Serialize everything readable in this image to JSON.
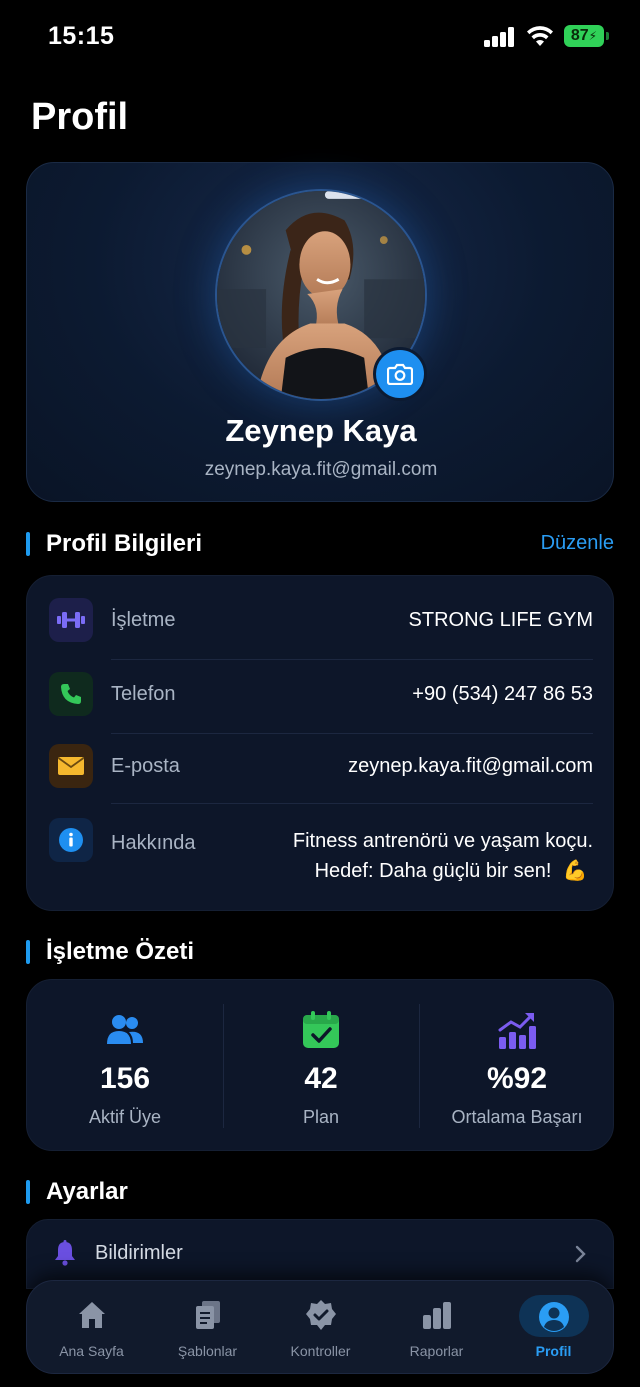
{
  "status_bar": {
    "time": "15:15",
    "battery": "87"
  },
  "page": {
    "title": "Profil"
  },
  "profile": {
    "name": "Zeynep Kaya",
    "email": "zeynep.kaya.fit@gmail.com"
  },
  "profile_info": {
    "title": "Profil Bilgileri",
    "edit_label": "Düzenle",
    "rows": [
      {
        "label": "İşletme",
        "value": "STRONG LIFE GYM",
        "icon": "dumbbell-icon"
      },
      {
        "label": "Telefon",
        "value": "+90 (534) 247 86 53",
        "icon": "phone-icon"
      },
      {
        "label": "E-posta",
        "value": "zeynep.kaya.fit@gmail.com",
        "icon": "mail-icon"
      },
      {
        "label": "Hakkında",
        "value_line1": "Fitness antrenörü ve yaşam koçu.",
        "value_line2": "Hedef: Daha güçlü bir sen!",
        "emoji": "💪",
        "icon": "info-icon"
      }
    ]
  },
  "business_summary": {
    "title": "İşletme Özeti",
    "stats": [
      {
        "value": "156",
        "label": "Aktif Üye",
        "icon": "users-icon",
        "color": "#2a8cf0"
      },
      {
        "value": "42",
        "label": "Plan",
        "icon": "calendar-check-icon",
        "color": "#34c759"
      },
      {
        "value": "%92",
        "label": "Ortalama Başarı",
        "icon": "growth-chart-icon",
        "color": "#7b5cf0"
      }
    ]
  },
  "settings": {
    "title": "Ayarlar",
    "items": [
      {
        "label": "Bildirimler",
        "icon": "bell-icon"
      }
    ]
  },
  "tab_bar": {
    "tabs": [
      {
        "label": "Ana Sayfa",
        "icon": "home-icon",
        "active": false
      },
      {
        "label": "Şablonlar",
        "icon": "documents-icon",
        "active": false
      },
      {
        "label": "Kontroller",
        "icon": "verified-badge-icon",
        "active": false
      },
      {
        "label": "Raporlar",
        "icon": "bar-chart-icon",
        "active": false
      },
      {
        "label": "Profil",
        "icon": "user-circle-icon",
        "active": true
      }
    ]
  },
  "colors": {
    "accent": "#2a9df4",
    "card_bg": "#0d1629",
    "text_secondary": "#a9b4c4"
  }
}
